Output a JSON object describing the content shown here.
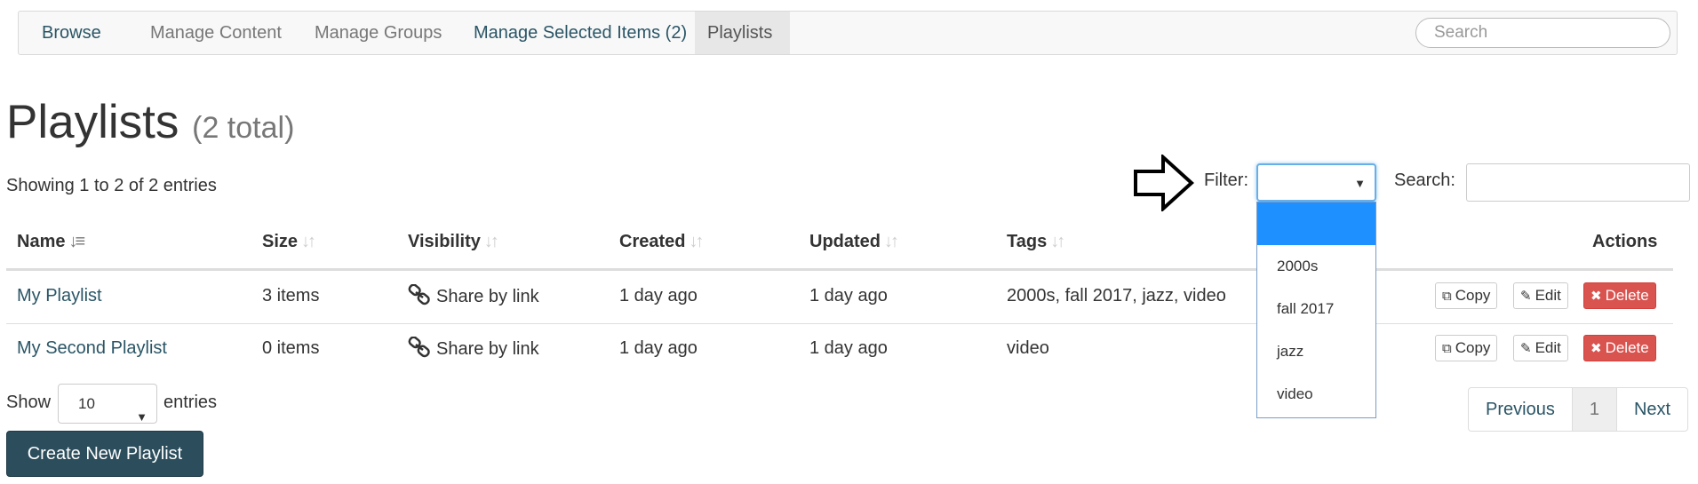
{
  "nav": {
    "items": [
      {
        "label": "Browse"
      },
      {
        "label": "Manage Content"
      },
      {
        "label": "Manage Groups"
      },
      {
        "label": "Manage Selected Items (2)"
      },
      {
        "label": "Playlists"
      }
    ],
    "search_placeholder": "Search"
  },
  "page": {
    "title": "Playlists",
    "total": "(2 total)",
    "showing": "Showing 1 to 2 of 2 entries"
  },
  "filter": {
    "label": "Filter:",
    "selected": "",
    "options": [
      "",
      "2000s",
      "fall 2017",
      "jazz",
      "video"
    ]
  },
  "search": {
    "label": "Search:",
    "value": ""
  },
  "table": {
    "headers": [
      "Name",
      "Size",
      "Visibility",
      "Created",
      "Updated",
      "Tags",
      "Actions"
    ],
    "rows": [
      {
        "name": "My Playlist",
        "size": "3 items",
        "visibility": "Share by link",
        "created": "1 day ago",
        "updated": "1 day ago",
        "tags": "2000s, fall 2017, jazz, video"
      },
      {
        "name": "My Second Playlist",
        "size": "0 items",
        "visibility": "Share by link",
        "created": "1 day ago",
        "updated": "1 day ago",
        "tags": "video"
      }
    ],
    "actions": {
      "copy": "Copy",
      "edit": "Edit",
      "delete": "Delete"
    }
  },
  "length": {
    "show_label": "Show",
    "value": "10",
    "entries_label": "entries"
  },
  "create_button": "Create New Playlist",
  "pagination": {
    "previous": "Previous",
    "current": "1",
    "next": "Next"
  },
  "colors": {
    "link": "#2a5566",
    "danger": "#d9534f",
    "primary": "#2c4d5c",
    "highlight": "#1e90ff"
  }
}
